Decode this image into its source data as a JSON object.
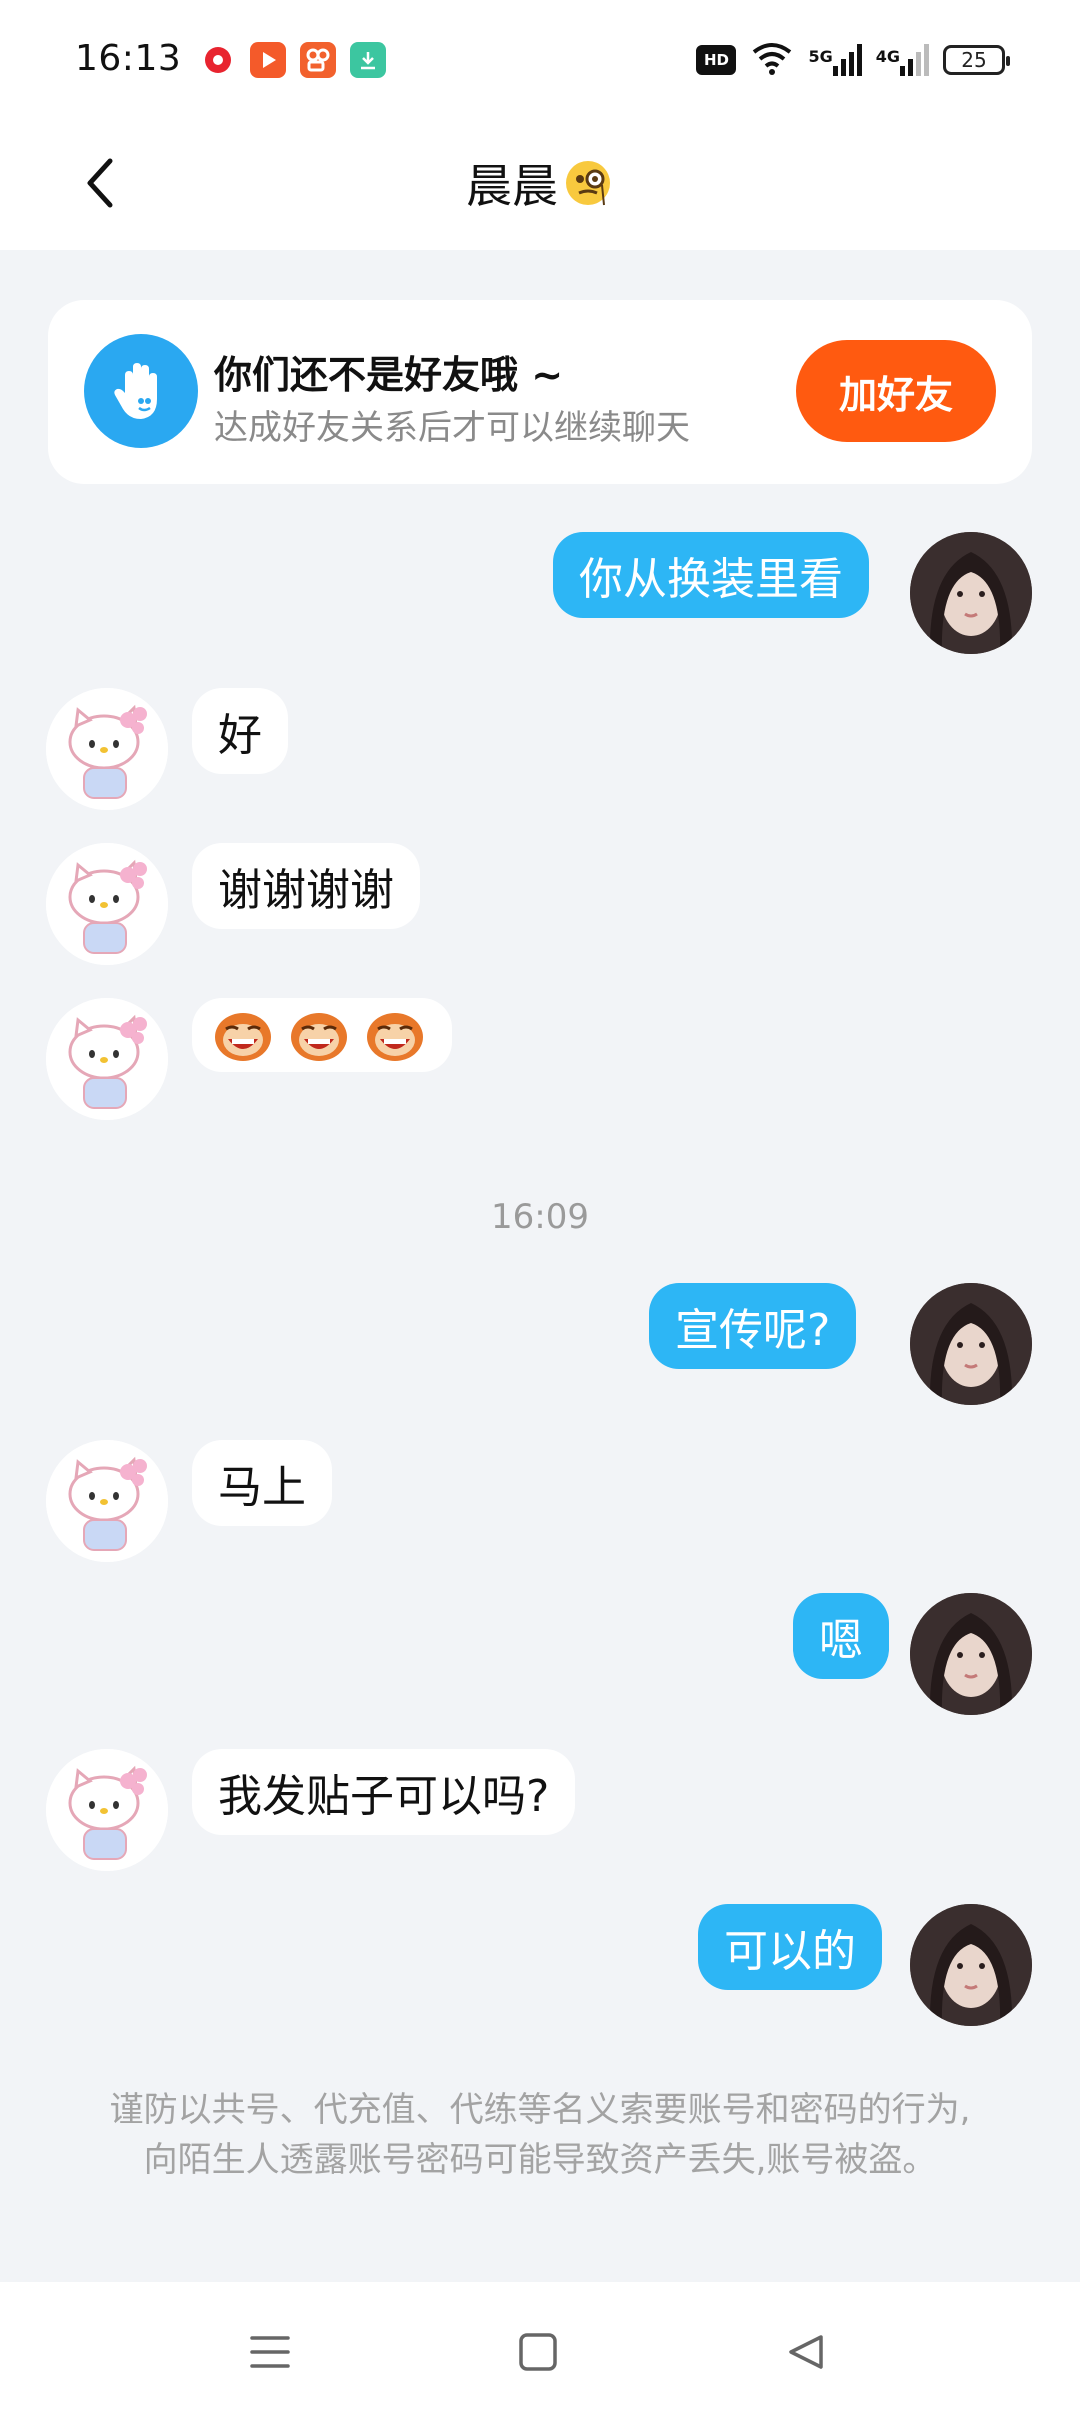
{
  "status_bar": {
    "time": "16:13",
    "hd": "HD",
    "net1": "5G",
    "net2": "4G",
    "battery": "25",
    "icons": [
      "record-app-icon",
      "play-app-icon",
      "kuai-app-icon",
      "download-icon",
      "wifi-icon"
    ]
  },
  "header": {
    "title": "晨晨",
    "back_icon": "chevron-left-icon",
    "title_emoji": "monocle-face-emoji"
  },
  "friend_card": {
    "title": "你们还不是好友哦 ~",
    "subtitle": "达成好友关系后才可以继续聊天",
    "button": "加好友",
    "icon": "hand-icon",
    "colors": {
      "button": "#ff5a10",
      "icon_bg": "#2aa8f1"
    }
  },
  "messages": [
    {
      "side": "out",
      "text": "你从换装里看"
    },
    {
      "side": "in",
      "text": "好"
    },
    {
      "side": "in",
      "text": "谢谢谢谢"
    },
    {
      "side": "in",
      "text": "",
      "stickers": [
        "monkey-laugh-sticker",
        "monkey-laugh-sticker",
        "monkey-laugh-sticker"
      ]
    },
    {
      "side": "out",
      "text": "宣传呢?"
    },
    {
      "side": "in",
      "text": "马上"
    },
    {
      "side": "out",
      "text": "嗯"
    },
    {
      "side": "in",
      "text": "我发贴子可以吗?"
    },
    {
      "side": "out",
      "text": "可以的"
    }
  ],
  "timestamp": "16:09",
  "warning": "谨防以共号、代充值、代练等名义索要账号和密码的行为,向陌生人透露账号密码可能导致资产丢失,账号被盗。",
  "colors": {
    "outgoing_bubble": "#2db6f5",
    "incoming_bubble": "#ffffff",
    "background": "#f2f4f7"
  },
  "nav": {
    "icons": [
      "menu-icon",
      "home-square-icon",
      "back-triangle-icon"
    ]
  }
}
